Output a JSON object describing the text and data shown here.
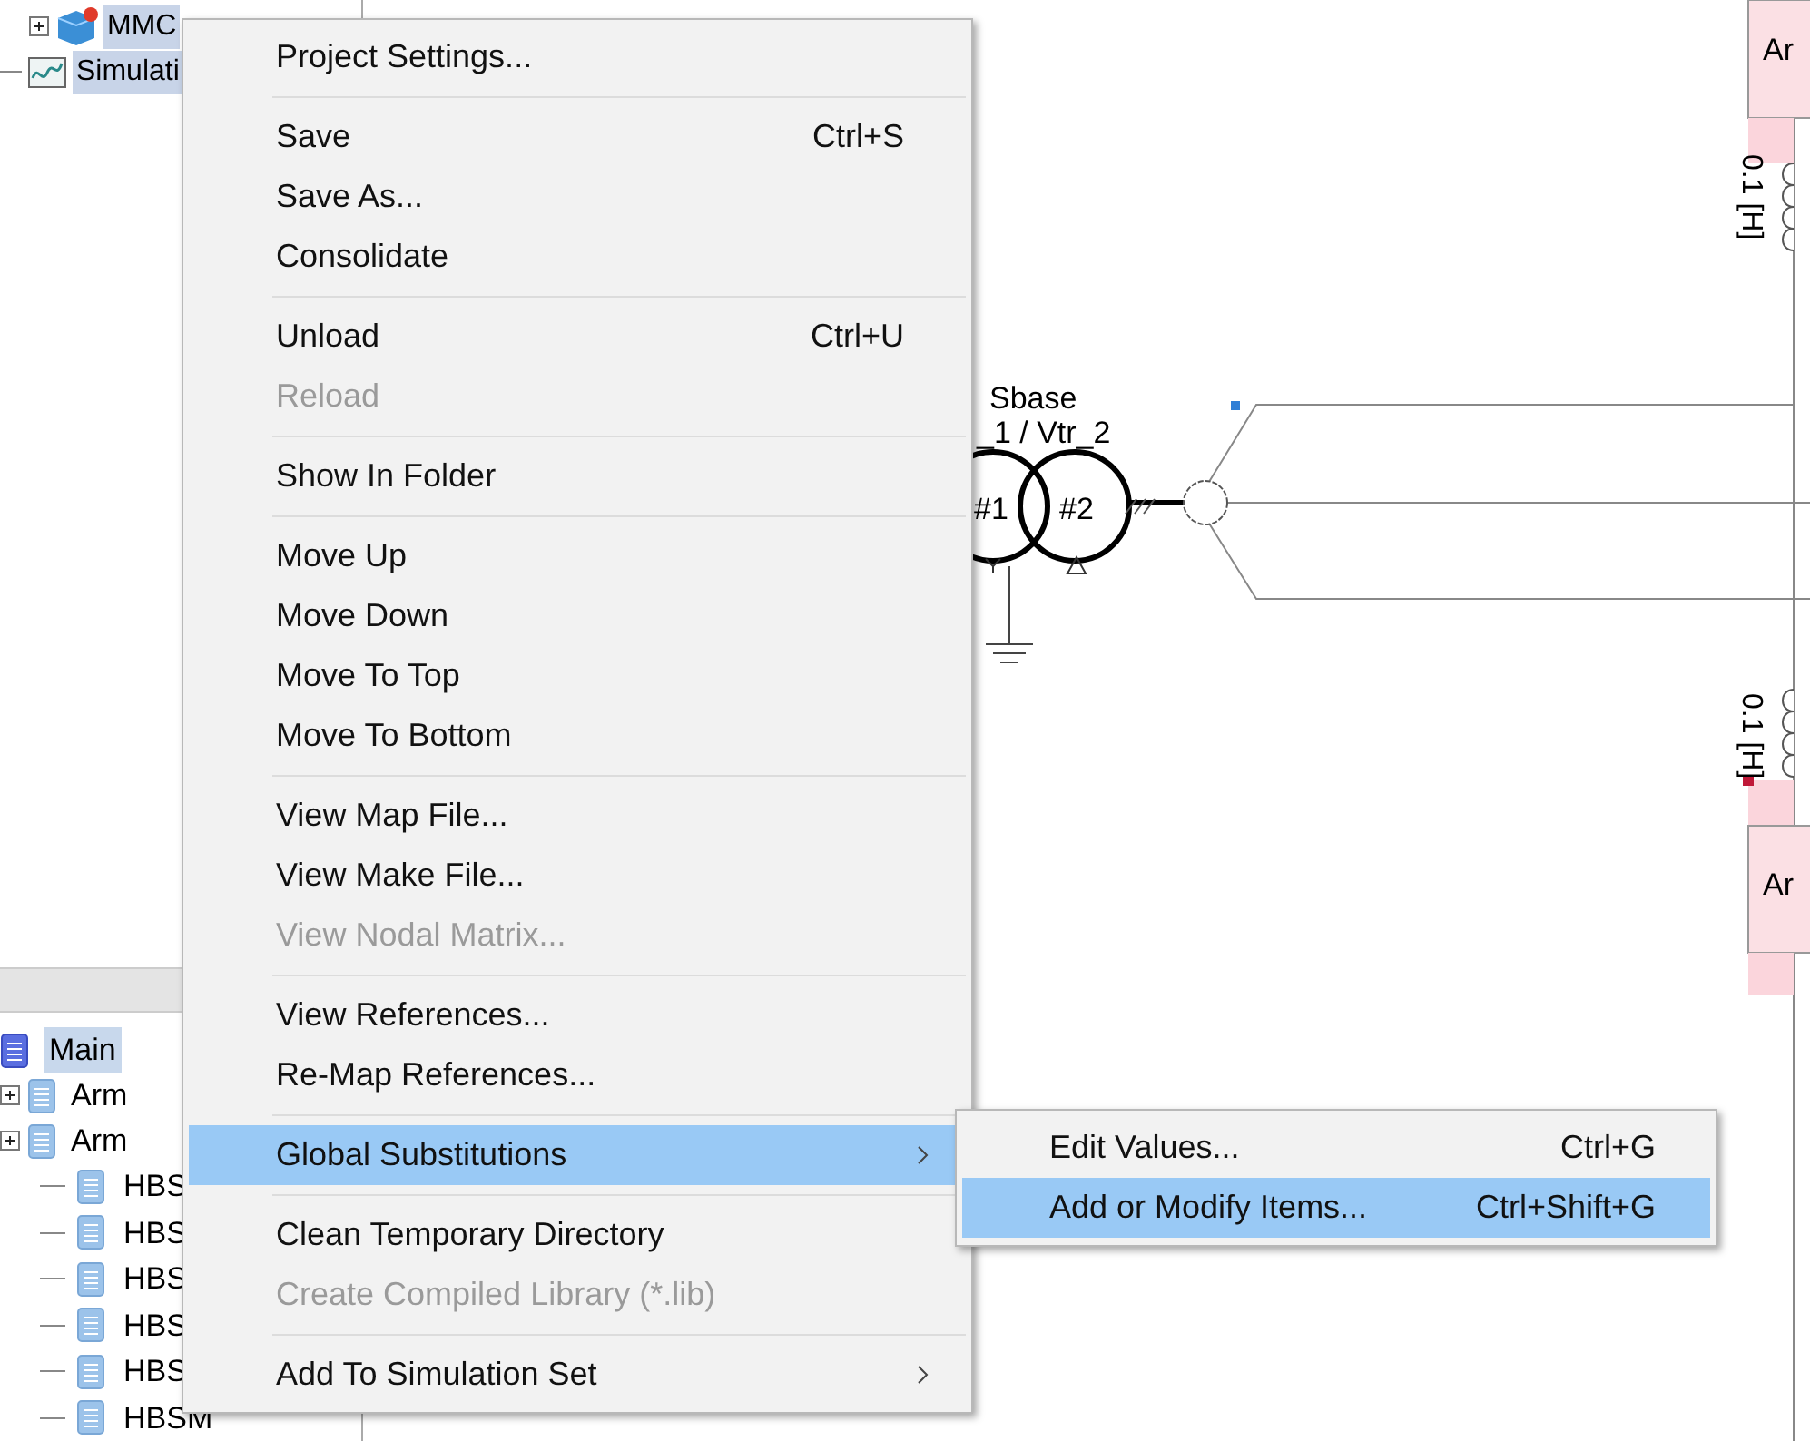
{
  "project_tree": [
    {
      "label": "MMC",
      "kind": "project",
      "expander": true
    },
    {
      "label": "Simulati",
      "kind": "simulation",
      "expander": false
    }
  ],
  "definitions_tree": {
    "root": {
      "label": "Main",
      "selected": true
    },
    "children": [
      {
        "label": "Arm",
        "expander": true
      },
      {
        "label": "Arm",
        "expander": true,
        "children": [
          {
            "label": "HBS"
          },
          {
            "label": "HBS"
          },
          {
            "label": "HBS"
          },
          {
            "label": "HBS"
          },
          {
            "label": "HBS"
          },
          {
            "label": "HBSM"
          }
        ]
      }
    ]
  },
  "schematic": {
    "transformer": {
      "rating": "Sbase",
      "voltages": "_1 / Vtr_2",
      "winding_1": "#1",
      "winding_2": "#2"
    },
    "arm_blocks": [
      {
        "label": "Ar"
      },
      {
        "label": "Ar"
      }
    ],
    "inductors": [
      {
        "value": "0.1 [H]"
      },
      {
        "value": "0.1 [H]"
      }
    ]
  },
  "context_menu": {
    "groups": [
      [
        {
          "label": "Project Settings...",
          "disabled": false,
          "selected": false
        }
      ],
      [
        {
          "label": "Save",
          "shortcut": "Ctrl+S",
          "disabled": false,
          "selected": false
        },
        {
          "label": "Save As...",
          "disabled": false,
          "selected": false
        },
        {
          "label": "Consolidate",
          "disabled": false,
          "selected": false
        }
      ],
      [
        {
          "label": "Unload",
          "shortcut": "Ctrl+U",
          "disabled": false,
          "selected": false
        },
        {
          "label": "Reload",
          "disabled": true,
          "selected": false
        }
      ],
      [
        {
          "label": "Show In Folder",
          "disabled": false,
          "selected": false
        }
      ],
      [
        {
          "label": "Move Up",
          "disabled": false,
          "selected": false
        },
        {
          "label": "Move Down",
          "disabled": false,
          "selected": false
        },
        {
          "label": "Move To Top",
          "disabled": false,
          "selected": false
        },
        {
          "label": "Move To Bottom",
          "disabled": false,
          "selected": false
        }
      ],
      [
        {
          "label": "View Map File...",
          "disabled": false,
          "selected": false
        },
        {
          "label": "View Make File...",
          "disabled": false,
          "selected": false
        },
        {
          "label": "View Nodal Matrix...",
          "disabled": true,
          "selected": false
        }
      ],
      [
        {
          "label": "View References...",
          "disabled": false,
          "selected": false
        },
        {
          "label": "Re-Map References...",
          "disabled": false,
          "selected": false
        }
      ],
      [
        {
          "label": "Global Substitutions",
          "submenu": true,
          "disabled": false,
          "selected": true
        }
      ],
      [
        {
          "label": "Clean Temporary Directory",
          "disabled": false,
          "selected": false
        },
        {
          "label": "Create Compiled Library (*.lib)",
          "disabled": true,
          "selected": false
        }
      ],
      [
        {
          "label": "Add To Simulation Set",
          "submenu": true,
          "disabled": false,
          "selected": false
        }
      ]
    ]
  },
  "submenu": [
    {
      "label": "Edit Values...",
      "shortcut": "Ctrl+G",
      "selected": false
    },
    {
      "label": "Add or Modify Items...",
      "shortcut": "Ctrl+Shift+G",
      "selected": true
    }
  ]
}
